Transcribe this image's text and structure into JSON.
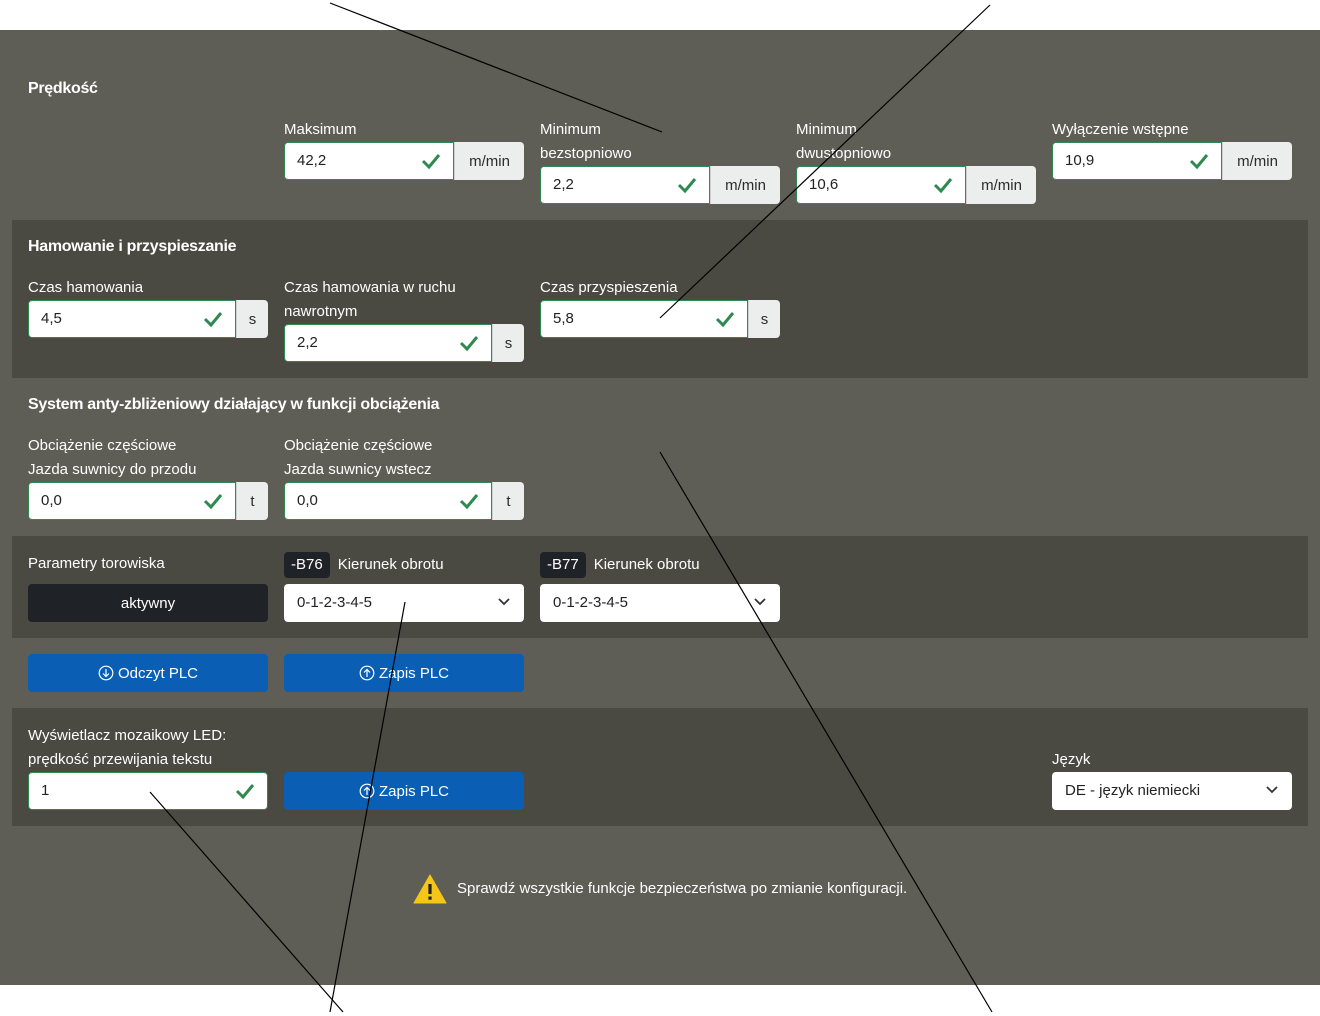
{
  "speed": {
    "title": "Prędkość",
    "max": {
      "label": "Maksimum",
      "value": "42,2",
      "unit": "m/min"
    },
    "min_stepless": {
      "label_line1": "Minimum",
      "label_line2": "bezstopniowo",
      "value": "2,2",
      "unit": "m/min"
    },
    "min_twostep": {
      "label_line1": "Minimum",
      "label_line2": "dwustopniowo",
      "value": "10,6",
      "unit": "m/min"
    },
    "pre_shutdown": {
      "label": "Wyłączenie wstępne",
      "value": "10,9",
      "unit": "m/min"
    }
  },
  "braking": {
    "title": "Hamowanie i przyspieszanie",
    "brake_time": {
      "label": "Czas hamowania",
      "value": "4,5",
      "unit": "s"
    },
    "brake_reverse": {
      "label_line1": "Czas hamowania w ruchu",
      "label_line2": "nawrotnym",
      "value": "2,2",
      "unit": "s"
    },
    "accel_time": {
      "label": "Czas przyspieszenia",
      "value": "5,8",
      "unit": "s"
    }
  },
  "anti_collision": {
    "title": "System anty-zbliżeniowy działający w funkcji obciążenia",
    "forward": {
      "label_line1": "Obciążenie częściowe",
      "label_line2": "Jazda suwnicy do przodu",
      "value": "0,0",
      "unit": "t"
    },
    "backward": {
      "label_line1": "Obciążenie częściowe",
      "label_line2": "Jazda suwnicy wstecz",
      "value": "0,0",
      "unit": "t"
    }
  },
  "track": {
    "label": "Parametry torowiska",
    "status_button": "aktywny",
    "b76": {
      "tag": "-B76",
      "label": "Kierunek obrotu",
      "selected": "0-1-2-3-4-5"
    },
    "b77": {
      "tag": "-B77",
      "label": "Kierunek obrotu",
      "selected": "0-1-2-3-4-5"
    }
  },
  "plc": {
    "read_label": "Odczyt PLC",
    "write_label": "Zapis PLC"
  },
  "led": {
    "label_line1": "Wyświetlacz mozaikowy LED:",
    "label_line2": "prędkość przewijania tekstu",
    "value": "1",
    "write_label": "Zapis PLC"
  },
  "language": {
    "label": "Język",
    "selected": "DE - język niemiecki"
  },
  "warning": {
    "text": "Sprawdź wszystkie funkcje bezpieczeństwa po zmianie konfiguracji."
  },
  "colors": {
    "panel": "#5f5e56",
    "band": "#4a4a43",
    "primary": "#0a5fb4",
    "valid": "#2f8a4f",
    "warning": "#f5c518"
  },
  "icons": [
    "check-icon",
    "chevron-down-icon",
    "arrow-down-circle-icon",
    "arrow-up-circle-icon",
    "warning-icon"
  ]
}
